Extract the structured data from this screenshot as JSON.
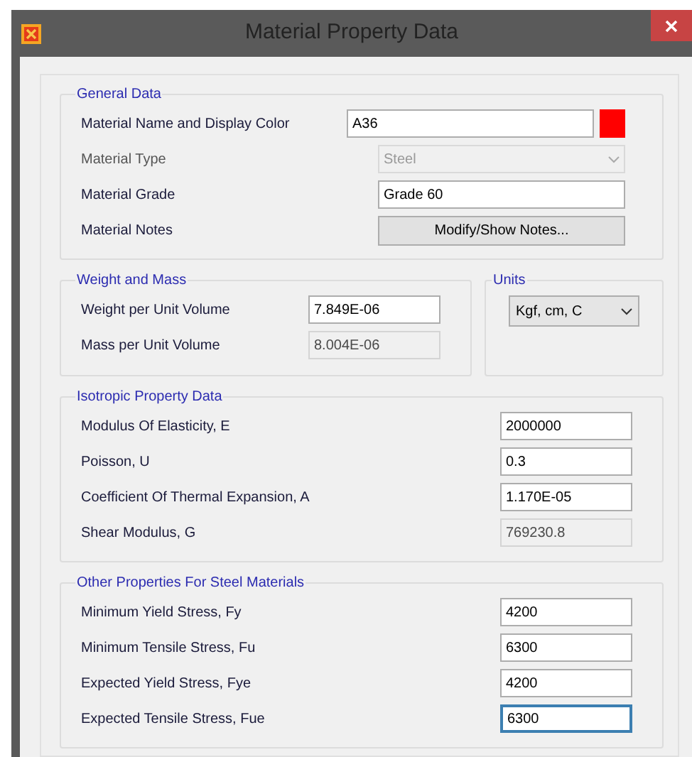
{
  "window": {
    "title": "Material Property Data"
  },
  "general": {
    "title": "General Data",
    "rows": [
      {
        "kind": "text",
        "label": "Material Name and Display Color",
        "value": "A36",
        "color": "#ff0000"
      },
      {
        "kind": "select",
        "label": "Material Type",
        "value": "Steel",
        "disabled": true
      },
      {
        "kind": "text",
        "label": "Material Grade",
        "value": "Grade 60"
      },
      {
        "kind": "button",
        "label": "Material Notes",
        "value": "Modify/Show Notes..."
      }
    ]
  },
  "weight_and_mass": {
    "title": "Weight and Mass",
    "rows": [
      {
        "kind": "text",
        "label": "Weight per Unit Volume",
        "value": "7.849E-06",
        "disabled": false
      },
      {
        "kind": "text",
        "label": "Mass per Unit Volume",
        "value": "8.004E-06",
        "disabled": true
      }
    ]
  },
  "units": {
    "title": "Units",
    "value": "Kgf, cm, C"
  },
  "isotropic": {
    "title": "Isotropic Property Data",
    "rows": [
      {
        "kind": "text",
        "label": "Modulus Of Elasticity,  E",
        "value": "2000000",
        "disabled": false
      },
      {
        "kind": "text",
        "label": "Poisson,  U",
        "value": "0.3",
        "disabled": false
      },
      {
        "kind": "text",
        "label": "Coefficient Of Thermal Expansion,  A",
        "value": "1.170E-05",
        "disabled": false
      },
      {
        "kind": "text",
        "label": "Shear Modulus,  G",
        "value": "769230.8",
        "disabled": true
      }
    ]
  },
  "steel": {
    "title": "Other Properties For Steel Materials",
    "rows": [
      {
        "kind": "text",
        "label": "Minimum Yield Stress, Fy",
        "value": "4200",
        "focused": false
      },
      {
        "kind": "text",
        "label": "Minimum Tensile Stress, Fu",
        "value": "6300",
        "focused": false
      },
      {
        "kind": "text",
        "label": "Expected Yield Stress, Fye",
        "value": "4200",
        "focused": false
      },
      {
        "kind": "text",
        "label": "Expected Tensile Stress, Fue",
        "value": "6300",
        "focused": true
      }
    ]
  }
}
